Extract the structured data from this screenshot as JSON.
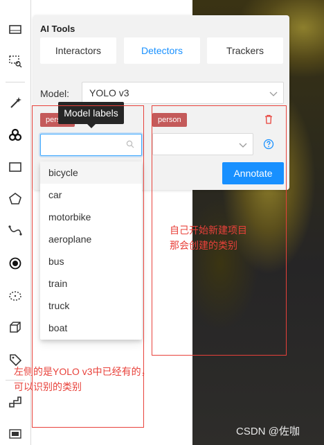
{
  "panel": {
    "title": "AI Tools",
    "tabs": [
      {
        "label": "Interactors"
      },
      {
        "label": "Detectors"
      },
      {
        "label": "Trackers"
      }
    ],
    "model_label": "Model:",
    "model_value": "YOLO v3",
    "left_tag": "person",
    "right_tag": "person",
    "annotate_label": "Annotate"
  },
  "tooltip": {
    "text": "Model labels"
  },
  "search": {
    "value": "",
    "placeholder": ""
  },
  "dropdown": {
    "items": [
      "bicycle",
      "car",
      "motorbike",
      "aeroplane",
      "bus",
      "train",
      "truck",
      "boat"
    ]
  },
  "notes": {
    "right_line1": "自己开始新建项目",
    "right_line2": "那会创建的类别",
    "left_line1": "左侧的是YOLO v3中已经有的，",
    "left_line2": "可以识别的类别"
  },
  "watermark": "CSDN @佐咖",
  "colors": {
    "accent": "#1890ff",
    "tag": "#c45a5a",
    "annotation_red": "#e8413a"
  }
}
